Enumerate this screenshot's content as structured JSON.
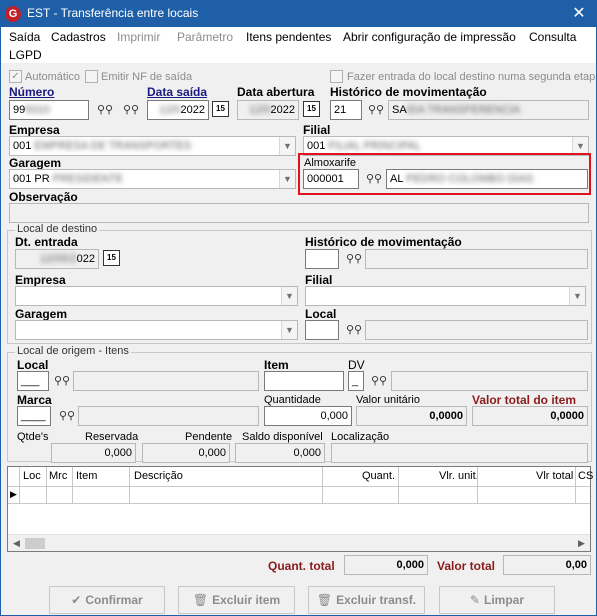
{
  "window": {
    "title": "EST - Transferência entre locais",
    "logo_letter": "G",
    "close_glyph": "✕"
  },
  "menu": {
    "items": [
      "Saída",
      "Cadastros",
      "Imprimir",
      "Parâmetro",
      "Itens pendentes",
      "Abrir configuração de impressão",
      "Consulta",
      "LGPD"
    ]
  },
  "options": {
    "automatico": "Automático",
    "emitir_nf": "Emitir NF de saída",
    "fazer_entrada": "Fazer entrada do local destino numa segunda etapa"
  },
  "header": {
    "numero_label": "Número",
    "numero_value": "99",
    "data_saida_label": "Data saída",
    "data_saida_value": "2022",
    "data_abertura_label": "Data abertura",
    "data_abertura_value": "2022",
    "historico_label": "Histórico de movimentação",
    "historico_code": "21",
    "historico_desc": "SA"
  },
  "empresa": {
    "label": "Empresa",
    "value": "001"
  },
  "filial": {
    "label": "Filial",
    "value": "001"
  },
  "garagem": {
    "label": "Garagem",
    "value": "001 PR"
  },
  "almoxarife": {
    "label": "Almoxarife",
    "code": "000001",
    "name": "AL"
  },
  "observacao": {
    "label": "Observação",
    "value": ""
  },
  "destino": {
    "group_title": "Local de destino",
    "dt_entrada_label": "Dt. entrada",
    "dt_entrada_value": "022",
    "historico_label": "Histórico de movimentação",
    "empresa_label": "Empresa",
    "filial_label": "Filial",
    "garagem_label": "Garagem",
    "local_label": "Local"
  },
  "origem": {
    "group_title": "Local de origem - Itens",
    "local_label": "Local",
    "local_value": "___",
    "item_label": "Item",
    "dv_label": "DV",
    "dv_value": "_",
    "marca_label": "Marca",
    "marca_value": "____",
    "quantidade_label": "Quantidade",
    "quantidade_value": "0,000",
    "valor_unitario_label": "Valor unitário",
    "valor_unitario_value": "0,0000",
    "valor_total_label": "Valor total do item",
    "valor_total_value": "0,0000",
    "qtdes_label": "Qtde's",
    "reservada_label": "Reservada",
    "reservada_value": "0,000",
    "pendente_label": "Pendente",
    "pendente_value": "0,000",
    "saldo_label": "Saldo disponível",
    "saldo_value": "0,000",
    "localizacao_label": "Localização"
  },
  "grid": {
    "columns": [
      "Loc",
      "Mrc",
      "Item",
      "Descrição",
      "Quant.",
      "Vlr. unit.",
      "Vlr total",
      "CS"
    ],
    "row_pointer": "▶"
  },
  "totals": {
    "quant_label": "Quant. total",
    "quant_value": "0,000",
    "valor_label": "Valor total",
    "valor_value": "0,00"
  },
  "buttons": {
    "confirmar": "Confirmar",
    "excluir_item": "Excluir item",
    "excluir_transf": "Excluir transf.",
    "limpar": "Limpar"
  },
  "icons": {
    "binoculars": "binoculars-icon",
    "calendar": "calendar-icon",
    "check": "check-icon",
    "trash": "trash-icon",
    "eraser": "eraser-icon"
  }
}
